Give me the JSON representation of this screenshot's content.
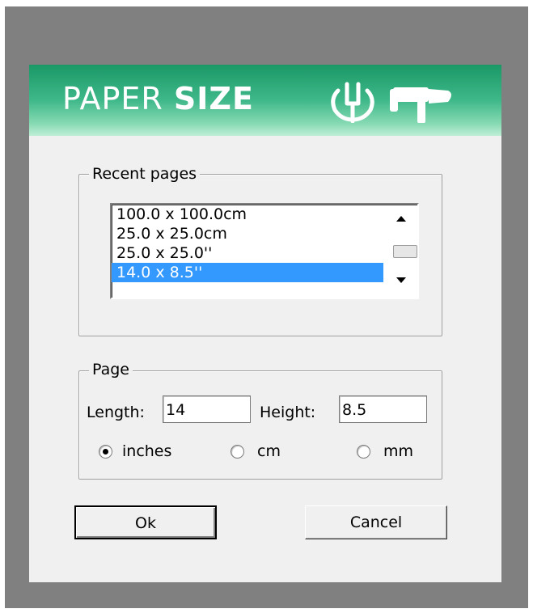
{
  "banner": {
    "title_light": "PAPER",
    "title_bold": "SIZE",
    "icons": [
      "wrench-icon",
      "hammer-icon"
    ]
  },
  "recent_group": {
    "legend": "Recent pages",
    "items": [
      {
        "label": "100.0 x 100.0cm",
        "selected": false
      },
      {
        "label": "25.0 x 25.0cm",
        "selected": false
      },
      {
        "label": "25.0 x 25.0''",
        "selected": false
      },
      {
        "label": "14.0 x 8.5''",
        "selected": true
      }
    ]
  },
  "page_group": {
    "legend": "Page",
    "length_label": "Length:",
    "length_value": "14",
    "height_label": "Height:",
    "height_value": "8.5",
    "units": [
      {
        "label": "inches",
        "checked": true
      },
      {
        "label": "cm",
        "checked": false
      },
      {
        "label": "mm",
        "checked": false
      }
    ]
  },
  "buttons": {
    "ok": "Ok",
    "cancel": "Cancel"
  },
  "colors": {
    "banner_dark": "#1a9866",
    "banner_light": "#bfeed6",
    "selection": "#3399ff",
    "backdrop": "#808080"
  }
}
